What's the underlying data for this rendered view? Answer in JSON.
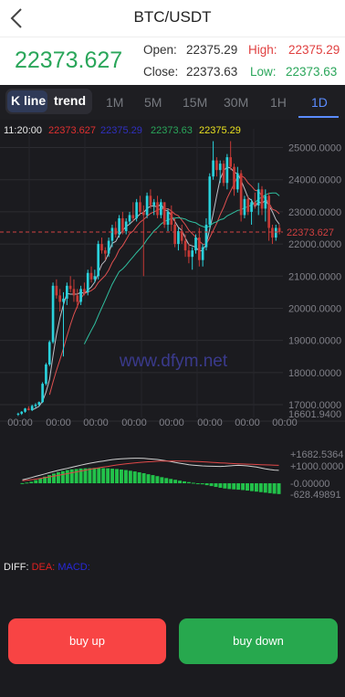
{
  "header": {
    "title": "BTC/USDT"
  },
  "ticker": {
    "price": "22373.627",
    "open_label": "Open:",
    "open_value": "22375.29",
    "high_label": "High:",
    "high_value": "22375.29",
    "close_label": "Close:",
    "close_value": "22373.63",
    "low_label": "Low:",
    "low_value": "22373.63"
  },
  "tabs": {
    "kline": "K line",
    "trend": "trend",
    "timeframes": [
      "1M",
      "5M",
      "15M",
      "30M",
      "1H",
      "1D"
    ],
    "active": "1D"
  },
  "info_line": {
    "time": "11:20:00",
    "values": [
      {
        "text": "22373.627",
        "color": "#e03030"
      },
      {
        "text": "22375.29",
        "color": "#3030c0"
      },
      {
        "text": "22373.63",
        "color": "#2aa65a"
      },
      {
        "text": "22375.29",
        "color": "#e8e020"
      }
    ]
  },
  "watermark": "www.dfym.net",
  "colors": {
    "up": "#2ad2dc",
    "down": "#c83a36",
    "ma_fast": "#c0c0c8",
    "ma_mid": "#e05050",
    "ma_slow": "#30c0a0",
    "macd_bar": "#22c24a",
    "diff_line": "#d0d0d0",
    "dea_line": "#e04848",
    "price_line": "#d04040"
  },
  "chart_data": [
    {
      "type": "candlestick",
      "price_axis": [
        25000,
        24000,
        23000,
        22000,
        21000,
        20000,
        19000,
        18000,
        17000
      ],
      "price_axis_labels": [
        "25000.0000",
        "24000.0000",
        "23000.0000",
        "22000.0000",
        "21000.0000",
        "20000.0000",
        "19000.0000",
        "18000.0000",
        "17000.0000"
      ],
      "min_label": "16601.9400",
      "last_price": "22373.627",
      "x_labels": [
        "00:00",
        "00:00",
        "00:00",
        "00:00",
        "00:00",
        "00:00",
        "00:00",
        "00:00"
      ],
      "ylim": [
        16601.94,
        25300
      ],
      "candles": [
        [
          16700,
          16750,
          16650,
          16720
        ],
        [
          16720,
          16800,
          16680,
          16780
        ],
        [
          16780,
          16900,
          16750,
          16880
        ],
        [
          16880,
          16950,
          16820,
          16830
        ],
        [
          16830,
          17000,
          16800,
          16960
        ],
        [
          16960,
          17050,
          16900,
          17000
        ],
        [
          17000,
          17100,
          16950,
          17080
        ],
        [
          17080,
          17700,
          17050,
          17650
        ],
        [
          17650,
          18300,
          17600,
          18250
        ],
        [
          18250,
          19000,
          18200,
          18950
        ],
        [
          18950,
          20800,
          18900,
          20700
        ],
        [
          20700,
          20900,
          20300,
          20400
        ],
        [
          20400,
          20600,
          19900,
          20200
        ],
        [
          20200,
          20500,
          18500,
          20300
        ],
        [
          20300,
          20800,
          20100,
          20700
        ],
        [
          20700,
          21000,
          20500,
          20600
        ],
        [
          20600,
          20900,
          20200,
          20400
        ],
        [
          20400,
          20600,
          20000,
          20200
        ],
        [
          20200,
          20700,
          20100,
          20600
        ],
        [
          20600,
          20800,
          20400,
          20500
        ],
        [
          20500,
          21200,
          20400,
          21100
        ],
        [
          21100,
          21300,
          20800,
          20900
        ],
        [
          20900,
          21200,
          20800,
          21000
        ],
        [
          21000,
          22100,
          20900,
          22000
        ],
        [
          22000,
          22200,
          21700,
          21800
        ],
        [
          21800,
          21900,
          21500,
          21700
        ],
        [
          21700,
          22200,
          21600,
          22100
        ],
        [
          22100,
          22600,
          21900,
          22500
        ],
        [
          22500,
          22700,
          22200,
          22300
        ],
        [
          22300,
          22900,
          22200,
          22800
        ],
        [
          22800,
          23000,
          22300,
          22400
        ],
        [
          22400,
          22800,
          22300,
          22700
        ],
        [
          22700,
          23000,
          22600,
          22900
        ],
        [
          22900,
          23300,
          22700,
          22800
        ],
        [
          22800,
          23400,
          22700,
          23300
        ],
        [
          23300,
          23500,
          22900,
          23000
        ],
        [
          23000,
          23200,
          21000,
          22900
        ],
        [
          22900,
          23600,
          22800,
          23500
        ],
        [
          23500,
          23700,
          23100,
          23200
        ],
        [
          23200,
          23400,
          22900,
          23300
        ],
        [
          23300,
          23500,
          22800,
          22900
        ],
        [
          22900,
          23400,
          22800,
          23300
        ],
        [
          23300,
          23300,
          22500,
          22600
        ],
        [
          22600,
          23100,
          22400,
          23000
        ],
        [
          23000,
          23200,
          22400,
          22600
        ],
        [
          22600,
          22800,
          21900,
          22000
        ],
        [
          22000,
          22500,
          21800,
          22400
        ],
        [
          22400,
          22600,
          22000,
          22100
        ],
        [
          22100,
          22300,
          21600,
          21800
        ],
        [
          21800,
          22000,
          21400,
          21600
        ],
        [
          21600,
          21900,
          21200,
          21800
        ],
        [
          21800,
          22300,
          21700,
          22200
        ],
        [
          22200,
          22500,
          21300,
          21500
        ],
        [
          21500,
          22000,
          21300,
          21900
        ],
        [
          21900,
          22800,
          21800,
          22600
        ],
        [
          22600,
          24200,
          22500,
          24100
        ],
        [
          24100,
          25200,
          24000,
          24600
        ],
        [
          24600,
          24700,
          24100,
          24300
        ],
        [
          24300,
          24600,
          23900,
          24500
        ],
        [
          24500,
          24600,
          23800,
          23900
        ],
        [
          23900,
          24800,
          23700,
          24700
        ],
        [
          24700,
          25200,
          24300,
          24400
        ],
        [
          24400,
          24500,
          23500,
          23700
        ],
        [
          23700,
          24400,
          23600,
          24200
        ],
        [
          24200,
          24300,
          22700,
          22900
        ],
        [
          22900,
          23500,
          22800,
          23400
        ],
        [
          23400,
          23500,
          22900,
          23000
        ],
        [
          23000,
          23400,
          22600,
          23300
        ],
        [
          23300,
          23600,
          23100,
          23200
        ],
        [
          23200,
          23900,
          22900,
          23700
        ],
        [
          23700,
          23800,
          22900,
          23100
        ],
        [
          23100,
          23700,
          22700,
          23500
        ],
        [
          23500,
          23600,
          22100,
          22500
        ],
        [
          22500,
          22600,
          22000,
          22200
        ],
        [
          22200,
          22600,
          22100,
          22500
        ],
        [
          22500,
          22600,
          22300,
          22374
        ]
      ]
    },
    {
      "type": "bar",
      "title": "MACD",
      "axis_labels": [
        "+1682.5364",
        "+1000.0000",
        "-0.00000",
        "-628.49891"
      ],
      "ylim": [
        -628.49891,
        1682.5364
      ],
      "hist": [
        10,
        40,
        90,
        180,
        290,
        380,
        470,
        560,
        640,
        700,
        760,
        800,
        820,
        850,
        860,
        870,
        880,
        880,
        870,
        860,
        840,
        820,
        790,
        760,
        720,
        680,
        630,
        580,
        520,
        470,
        410,
        350,
        300,
        250,
        200,
        150,
        110,
        70,
        30,
        -10,
        -60,
        -110,
        -160,
        -210,
        -260,
        -300,
        -330,
        -350,
        -370,
        -390,
        -420,
        -450,
        -480,
        -510,
        -540,
        -570,
        -600,
        -620
      ],
      "diff": [
        200,
        260,
        330,
        400,
        470,
        540,
        610,
        680,
        740,
        800,
        860,
        920,
        980,
        1040,
        1100,
        1150,
        1200,
        1240,
        1280,
        1320,
        1360,
        1390,
        1410,
        1420,
        1430,
        1440,
        1440,
        1430,
        1410,
        1390,
        1370,
        1330,
        1290,
        1250,
        1200,
        1150,
        1110,
        1070,
        1040,
        1020,
        1000,
        990,
        980,
        975,
        970,
        980,
        1000,
        1020,
        1030,
        1020,
        1000,
        970,
        930,
        880,
        830,
        790,
        760,
        740
      ],
      "dea": [
        150,
        175,
        205,
        240,
        280,
        320,
        365,
        410,
        455,
        505,
        555,
        605,
        655,
        705,
        755,
        800,
        845,
        890,
        930,
        970,
        1010,
        1050,
        1085,
        1115,
        1145,
        1170,
        1195,
        1215,
        1235,
        1250,
        1265,
        1275,
        1280,
        1285,
        1285,
        1280,
        1275,
        1265,
        1255,
        1245,
        1235,
        1220,
        1205,
        1190,
        1175,
        1160,
        1145,
        1130,
        1120,
        1110,
        1100,
        1090,
        1080,
        1070,
        1060,
        1050,
        1040,
        1030
      ]
    }
  ],
  "macd_legend": {
    "diff": "DIFF:",
    "dea": "DEA:",
    "macd": "MACD:"
  },
  "buttons": {
    "buy_up": "buy up",
    "buy_down": "buy down"
  }
}
